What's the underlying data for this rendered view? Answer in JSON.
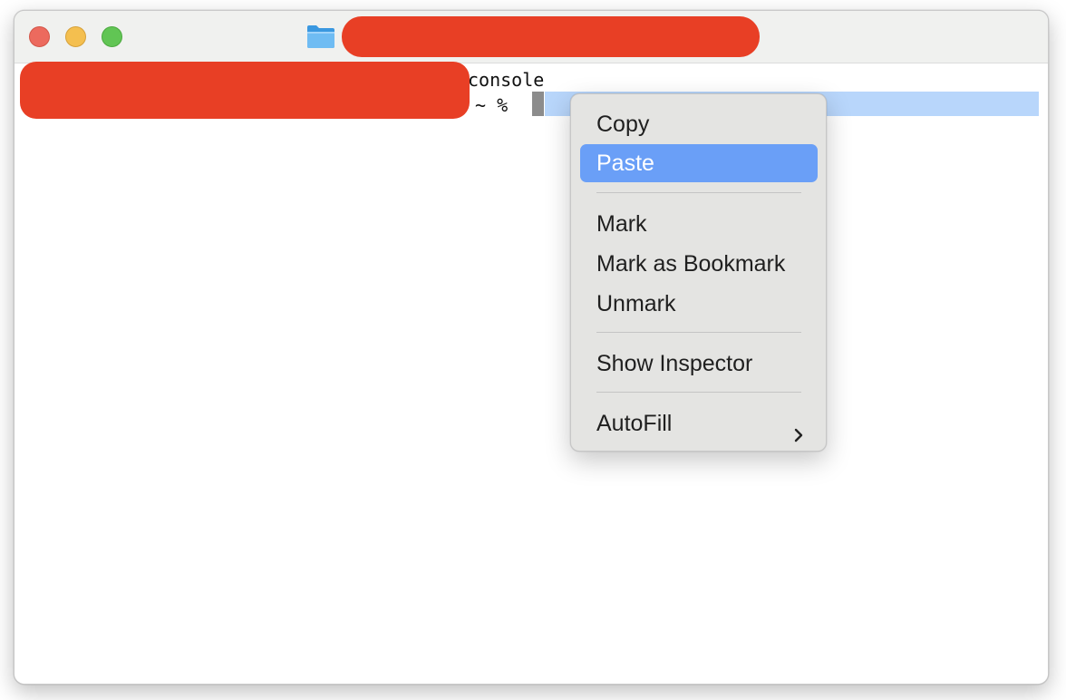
{
  "window": {
    "title_redacted": true
  },
  "terminal": {
    "line1_visible": "console",
    "line2_visible": " ~ % "
  },
  "context_menu": {
    "items": [
      {
        "label": "Copy"
      },
      {
        "label": "Paste"
      },
      {
        "label": "Mark"
      },
      {
        "label": "Mark as Bookmark"
      },
      {
        "label": "Unmark"
      },
      {
        "label": "Show Inspector"
      },
      {
        "label": "AutoFill"
      }
    ],
    "highlighted": "Paste"
  },
  "colors": {
    "redaction": "#e83f25",
    "highlight": "#6a9ff7",
    "selection": "#b8d6fb",
    "titlebar": "#f0f1ef"
  },
  "icons": {
    "title": "folder-icon",
    "submenu": "chevron-right-icon"
  }
}
